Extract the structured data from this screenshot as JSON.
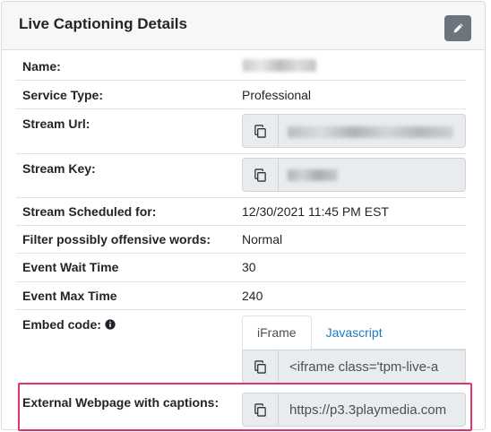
{
  "panel": {
    "title": "Live Captioning Details"
  },
  "rows": {
    "name": {
      "label": "Name:"
    },
    "service_type": {
      "label": "Service Type:",
      "value": "Professional"
    },
    "stream_url": {
      "label": "Stream Url:"
    },
    "stream_key": {
      "label": "Stream Key:"
    },
    "stream_scheduled": {
      "label": "Stream Scheduled for:",
      "value": "12/30/2021 11:45 PM EST"
    },
    "filter_words": {
      "label": "Filter possibly offensive words:",
      "value": "Normal"
    },
    "event_wait": {
      "label": "Event Wait Time",
      "value": "30"
    },
    "event_max": {
      "label": "Event Max Time",
      "value": "240"
    },
    "embed_code": {
      "label": "Embed code:",
      "tabs": [
        "iFrame",
        "Javascript"
      ],
      "active_tab": "iFrame",
      "value": "<iframe class='tpm-live-a"
    },
    "external_webpage": {
      "label": "External Webpage with captions:",
      "value": "https://p3.3playmedia.com"
    }
  },
  "colors": {
    "header_bg": "#f7f7f7",
    "edit_button": "#6c757d",
    "input_bg": "#e9ecef",
    "link": "#1f7bbf",
    "highlight": "#e2336b"
  },
  "icons": {
    "edit": "pencil-icon",
    "copy": "copy-icon",
    "info": "info-circle-icon"
  }
}
